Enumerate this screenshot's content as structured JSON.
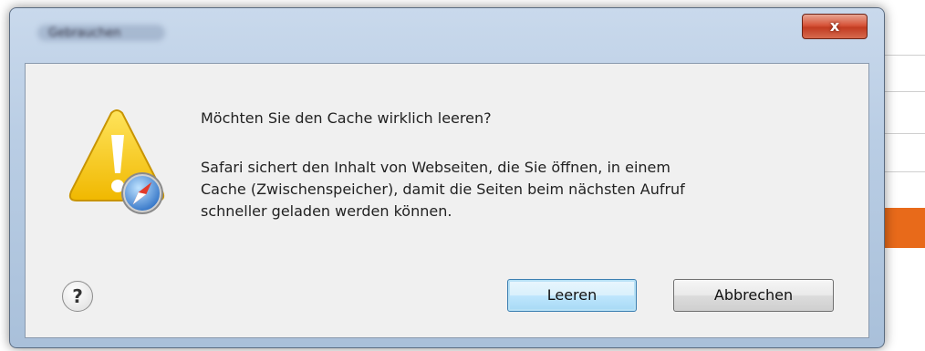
{
  "window": {
    "title": "Gebrauchen",
    "close_glyph": "x"
  },
  "dialog": {
    "heading": "Möchten Sie den Cache wirklich leeren?",
    "body_line1": "Safari sichert den Inhalt von Webseiten, die Sie öffnen, in einem",
    "body_line2": "Cache (Zwischenspeicher), damit die Seiten beim nächsten Aufruf",
    "body_line3": "schneller geladen werden können.",
    "help_glyph": "?",
    "buttons": {
      "confirm": "Leeren",
      "cancel": "Abbrechen"
    },
    "icons": {
      "warning": "warning-icon",
      "safari": "safari-compass-icon",
      "help": "help-icon"
    }
  },
  "colors": {
    "accent_orange": "#e86a1a",
    "warning_yellow": "#f2c200",
    "default_button_border": "#3c7fb1"
  }
}
